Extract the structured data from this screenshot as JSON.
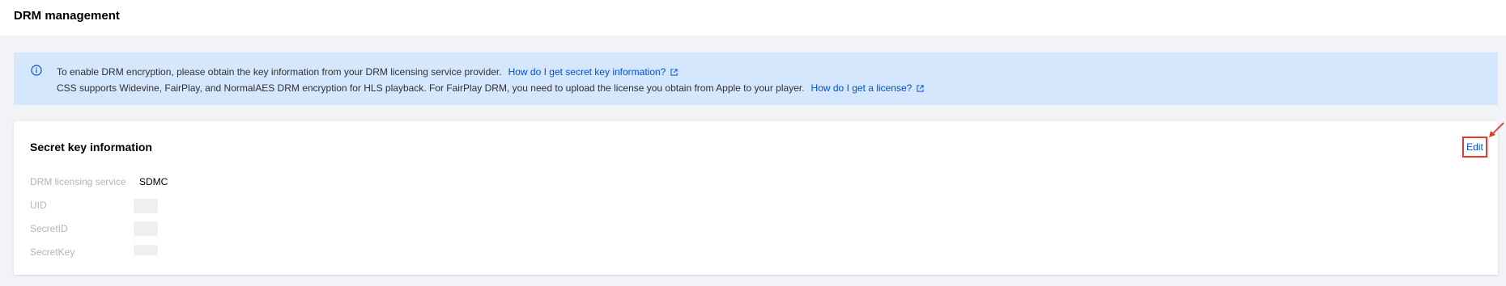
{
  "header": {
    "title": "DRM management"
  },
  "notice": {
    "line1_text": "To enable DRM encryption, please obtain the key information from your DRM licensing service provider.",
    "line1_link": "How do I get secret key information?",
    "line2_text": "CSS supports Widevine, FairPlay, and NormalAES DRM encryption for HLS playback. For FairPlay DRM, you need to upload the license you obtain from Apple to your player.",
    "line2_link": "How do I get a license?",
    "icon": "info-icon",
    "link_icon": "external-link-icon"
  },
  "card": {
    "title": "Secret key information",
    "edit_label": "Edit",
    "fields": [
      {
        "label": "DRM licensing service",
        "value": "SDMC"
      },
      {
        "label": "UID",
        "value": ""
      },
      {
        "label": "SecretID",
        "value": ""
      },
      {
        "label": "SecretKey",
        "value": ""
      }
    ]
  },
  "colors": {
    "accent": "#0052d9",
    "highlight": "#e23a33",
    "notice_bg": "#d5e7fd"
  }
}
